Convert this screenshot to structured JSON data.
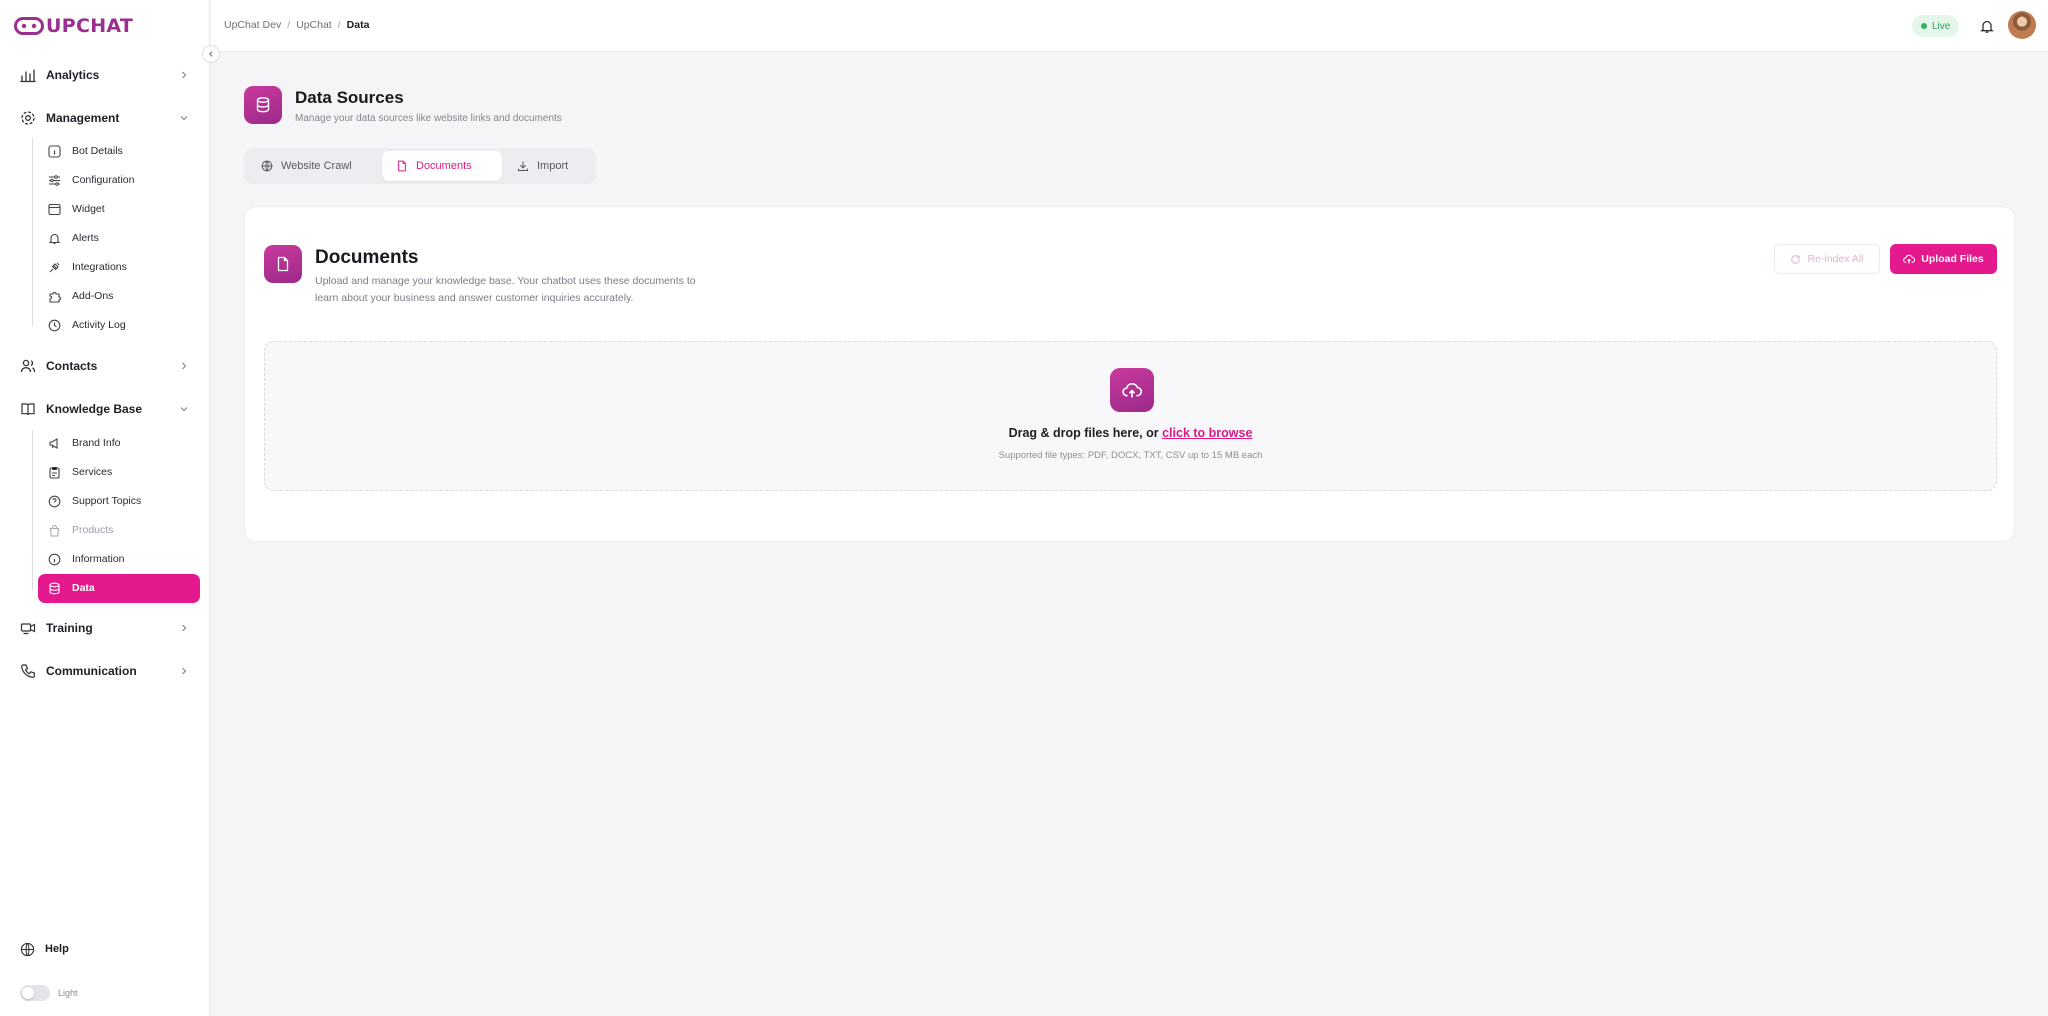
{
  "brand": {
    "logo_text": "UPCHAT",
    "accent": "#e3198d",
    "brand_purple": "#9c2e8f"
  },
  "sidebar": {
    "sections": [
      {
        "label": "Analytics",
        "icon": "bar-chart-icon",
        "expanded": false
      },
      {
        "label": "Management",
        "icon": "gear-icon",
        "expanded": true,
        "items": [
          {
            "label": "Bot Details",
            "icon": "info-square-icon"
          },
          {
            "label": "Configuration",
            "icon": "sliders-icon"
          },
          {
            "label": "Widget",
            "icon": "window-icon"
          },
          {
            "label": "Alerts",
            "icon": "bell-icon"
          },
          {
            "label": "Integrations",
            "icon": "plug-icon"
          },
          {
            "label": "Add-Ons",
            "icon": "puzzle-icon"
          },
          {
            "label": "Activity Log",
            "icon": "clock-icon"
          }
        ]
      },
      {
        "label": "Contacts",
        "icon": "users-icon",
        "expanded": false
      },
      {
        "label": "Knowledge Base",
        "icon": "book-icon",
        "expanded": true,
        "items": [
          {
            "label": "Brand Info",
            "icon": "megaphone-icon"
          },
          {
            "label": "Services",
            "icon": "clipboard-icon"
          },
          {
            "label": "Support Topics",
            "icon": "help-circle-icon"
          },
          {
            "label": "Products",
            "icon": "bag-icon",
            "disabled": true
          },
          {
            "label": "Information",
            "icon": "info-circle-icon"
          },
          {
            "label": "Data",
            "icon": "database-icon",
            "active": true
          }
        ]
      },
      {
        "label": "Training",
        "icon": "graduation-icon",
        "expanded": false
      },
      {
        "label": "Communication",
        "icon": "phone-icon",
        "expanded": false
      }
    ],
    "help_label": "Help",
    "theme_label": "Light"
  },
  "topbar": {
    "breadcrumb": [
      "UpChat Dev",
      "UpChat",
      "Data"
    ],
    "status_label": "Live",
    "status_color": "#2fb463"
  },
  "page": {
    "title": "Data Sources",
    "subtitle": "Manage your data sources like website links and documents",
    "tabs": [
      {
        "label": "Website Crawl",
        "icon": "globe-icon",
        "active": false
      },
      {
        "label": "Documents",
        "icon": "file-icon",
        "active": true
      },
      {
        "label": "Import",
        "icon": "download-icon",
        "active": false
      }
    ]
  },
  "documents": {
    "title": "Documents",
    "description": "Upload and manage your knowledge base. Your chatbot uses these documents to learn about your business and answer customer inquiries accurately.",
    "reindex_label": "Re-index All",
    "upload_label": "Upload Files",
    "dropzone": {
      "text": "Drag & drop files here, or",
      "link": "click to browse",
      "hint": "Supported file types: PDF, DOCX, TXT, CSV up to 15 MB each"
    }
  }
}
